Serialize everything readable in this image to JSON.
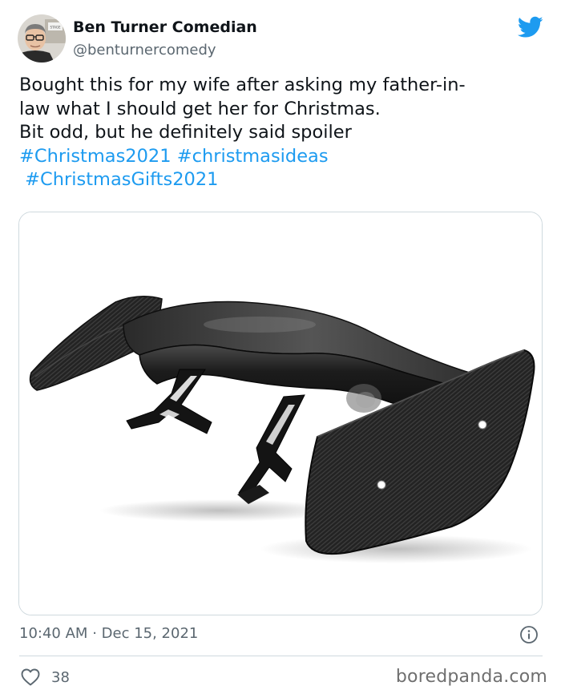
{
  "author": {
    "name": "Ben Turner Comedian",
    "handle": "@benturnercomedy",
    "avatar_badge_text": "STAGE"
  },
  "tweet": {
    "lines": [
      "Bought this for my wife after asking my father-in-",
      "law what I should get her for Christmas.",
      "Bit odd, but he definitely said spoiler"
    ],
    "hashtags": [
      "#Christmas2021",
      "#christmasideas",
      "#ChristmasGifts2021"
    ]
  },
  "meta": {
    "time": "10:40 AM",
    "separator": "·",
    "date": "Dec 15, 2021"
  },
  "engagement": {
    "likes": "38"
  },
  "watermark": "boredpanda.com",
  "colors": {
    "twitter_blue": "#1d9bf0",
    "text": "#0f1419",
    "secondary": "#5b6770",
    "border": "#cfd9de"
  },
  "icons": {
    "brand": "twitter-bird-icon",
    "info": "info-icon",
    "like": "heart-icon"
  }
}
